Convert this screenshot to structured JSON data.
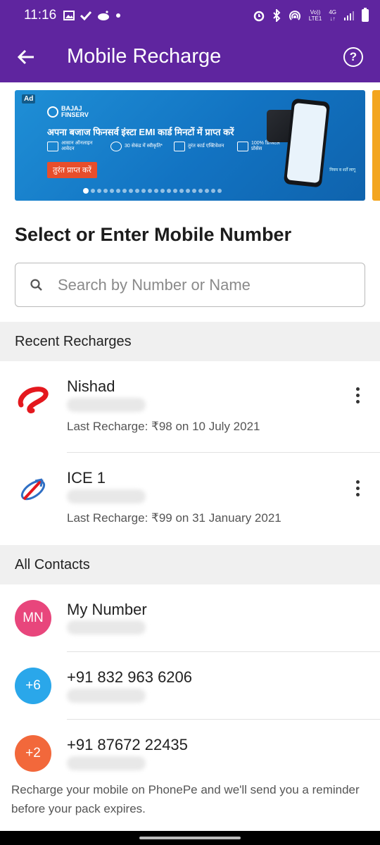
{
  "status_bar": {
    "time": "11:16",
    "left_icons": [
      "image-icon",
      "check-icon",
      "reddit-icon",
      "dot-icon"
    ],
    "right_icons": [
      "alarm-icon",
      "bluetooth-icon",
      "hotspot-icon",
      "volte-icon",
      "network-4g-icon",
      "signal-icon",
      "battery-icon"
    ],
    "volte_top": "Vo))",
    "volte_bottom": "LTE1",
    "net_top": "4G",
    "net_bottom": "↓↑"
  },
  "app_bar": {
    "title": "Mobile Recharge",
    "back_icon": "arrow-left-icon",
    "help_icon": "help-circle-icon",
    "color": "#5f259f"
  },
  "banner": {
    "ad_label": "Ad",
    "brand": "BAJAJ FINSERV",
    "headline": "अपना बजाज फिनसर्व इंस्टा EMI कार्ड मिनटों में प्राप्त करें",
    "features": [
      "आसान ऑनलाइन आवेदन",
      "30 सेकंड में स्वीकृति*",
      "तुरंत कार्ड एक्टिवेशन",
      "100% डिजिटल प्रोसेस"
    ],
    "cta": "तुरंत प्राप्त करें",
    "fine_print": "नियम व शर्तें लागू",
    "dots_total": 22,
    "dots_active_index": 0
  },
  "select_heading": "Select or Enter Mobile Number",
  "search": {
    "placeholder": "Search by Number or Name",
    "value": ""
  },
  "recent_section": {
    "title": "Recent Recharges",
    "items": [
      {
        "name": "Nishad",
        "last_recharge": "Last Recharge: ₹98 on 10 July 2021",
        "operator_icon": "airtel-logo-icon"
      },
      {
        "name": "ICE 1",
        "last_recharge": "Last Recharge: ₹99 on 31 January 2021",
        "operator_icon": "bsnl-logo-icon"
      }
    ]
  },
  "contacts_section": {
    "title": "All Contacts",
    "items": [
      {
        "avatar_text": "MN",
        "name": "My Number",
        "avatar_color": "#e8467c"
      },
      {
        "avatar_text": "+6",
        "name": "+91 832 963 6206",
        "avatar_color": "#2aa7ea"
      },
      {
        "avatar_text": "+2",
        "name": "+91 87672 22435",
        "avatar_color": "#f2683b"
      }
    ]
  },
  "footer_note": "Recharge your mobile on PhonePe and we'll send you a reminder before your pack expires."
}
